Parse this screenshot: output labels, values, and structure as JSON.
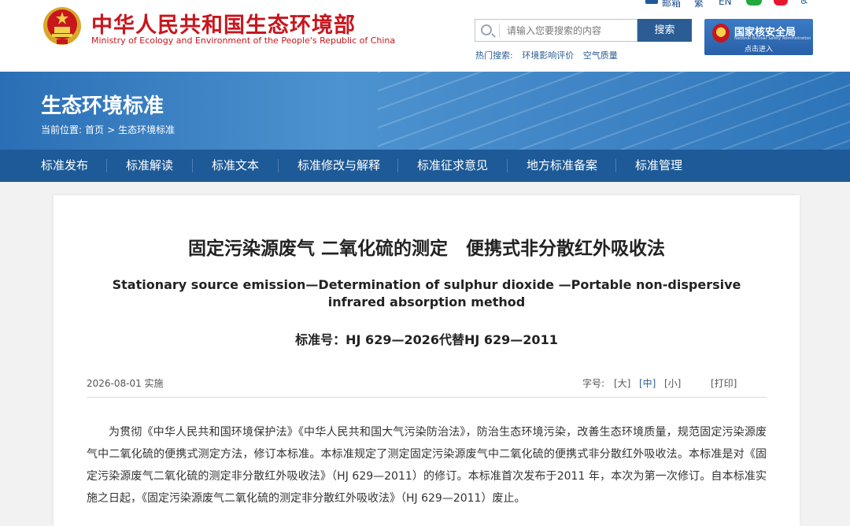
{
  "header": {
    "site_title": "中华人民共和国生态环境部",
    "site_subtitle": "Ministry of Ecology and Environment of the People's Republic of China",
    "toplinks": {
      "mail": "邮箱",
      "traditional": "繁",
      "english": "EN"
    },
    "search": {
      "placeholder": "请输入您要搜索的内容",
      "button": "搜索"
    },
    "hot_search": {
      "label": "热门搜索:",
      "items": [
        "环境影响评价",
        "空气质量"
      ]
    },
    "nnsa": {
      "title": "国家核安全局",
      "subtitle": "National Nuclear Safety Administration",
      "enter": "点击进入"
    }
  },
  "banner": {
    "title": "生态环境标准",
    "breadcrumb": {
      "label": "当前位置:",
      "home": "首页",
      "sep": ">",
      "current": "生态环境标准"
    }
  },
  "nav": {
    "items": [
      "标准发布",
      "标准解读",
      "标准文本",
      "标准修改与解释",
      "标准征求意见",
      "地方标准备案",
      "标准管理"
    ]
  },
  "article": {
    "title": "固定污染源废气 二氧化硫的测定　便携式非分散红外吸收法",
    "en_title": "Stationary source emission—Determination of sulphur dioxide —Portable non-dispersive infrared absorption method",
    "standard_no": "标准号：HJ 629—2026代替HJ 629—2011",
    "date": "2026-08-01 实施",
    "font_size": {
      "label": "字号:",
      "large": "[大]",
      "medium": "[中]",
      "small": "[小]",
      "print": "[打印]"
    },
    "body": "为贯彻《中华人民共和国环境保护法》《中华人民共和国大气污染防治法》，防治生态环境污染，改善生态环境质量，规范固定污染源废气中二氧化硫的便携式测定方法，修订本标准。本标准规定了测定固定污染源废气中二氧化硫的便携式非分散红外吸收法。本标准是对《固定污染源废气二氧化硫的测定非分散红外吸收法》（HJ 629—2011）的修订。本标准首次发布于2011 年，本次为第一次修订。自本标准实施之日起，《固定污染源废气二氧化硫的测定非分散红外吸收法》（HJ 629—2011）废止。"
  },
  "colors": {
    "brand_red": "#c8161d",
    "nav_blue": "#1d5a97",
    "banner_blue": "#3f85c6"
  }
}
